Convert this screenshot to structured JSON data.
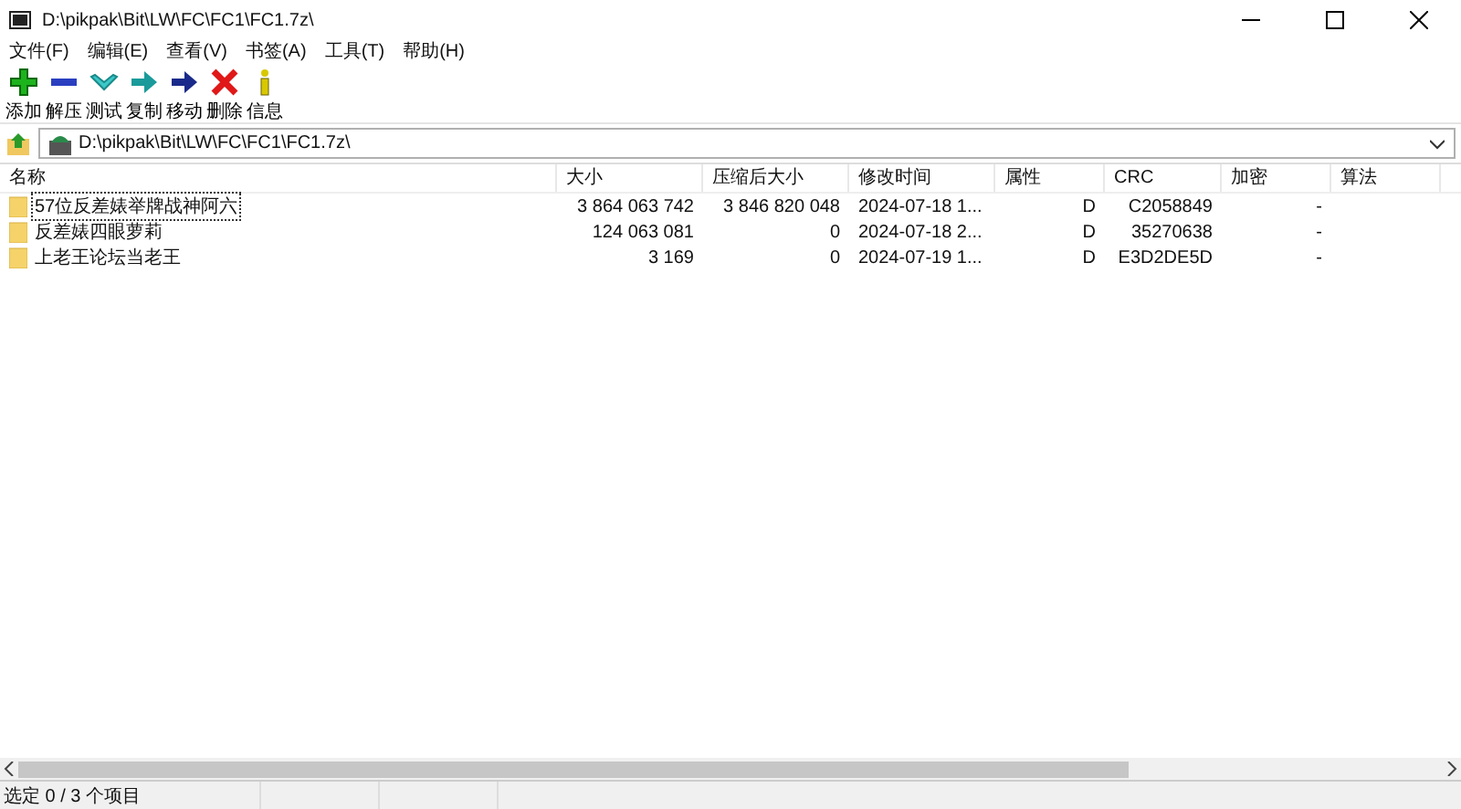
{
  "window": {
    "title": "D:\\pikpak\\Bit\\LW\\FC\\FC1\\FC1.7z\\"
  },
  "menu": [
    "文件(F)",
    "编辑(E)",
    "查看(V)",
    "书签(A)",
    "工具(T)",
    "帮助(H)"
  ],
  "toolbar": [
    {
      "kind": "add",
      "label": "添加"
    },
    {
      "kind": "extract",
      "label": "解压"
    },
    {
      "kind": "test",
      "label": "测试"
    },
    {
      "kind": "copy",
      "label": "复制"
    },
    {
      "kind": "move",
      "label": "移动"
    },
    {
      "kind": "delete",
      "label": "删除"
    },
    {
      "kind": "info",
      "label": "信息"
    }
  ],
  "address": {
    "value": "D:\\pikpak\\Bit\\LW\\FC\\FC1\\FC1.7z\\"
  },
  "table": {
    "columns": [
      "名称",
      "大小",
      "压缩后大小",
      "修改时间",
      "属性",
      "CRC",
      "加密",
      "算法"
    ],
    "rows": [
      {
        "focused": true,
        "cells": [
          "57位反差婊举牌战神阿六",
          "3 864 063 742",
          "3 846 820 048",
          "2024-07-18 1...",
          "D",
          "C2058849",
          "-",
          ""
        ]
      },
      {
        "focused": false,
        "cells": [
          "反差婊四眼萝莉",
          "124 063 081",
          "0",
          "2024-07-18 2...",
          "D",
          "35270638",
          "-",
          ""
        ]
      },
      {
        "focused": false,
        "cells": [
          "上老王论坛当老王",
          "3 169",
          "0",
          "2024-07-19 1...",
          "D",
          "E3D2DE5D",
          "-",
          ""
        ]
      }
    ]
  },
  "status_bar": {
    "text": "选定 0 / 3 个项目"
  }
}
